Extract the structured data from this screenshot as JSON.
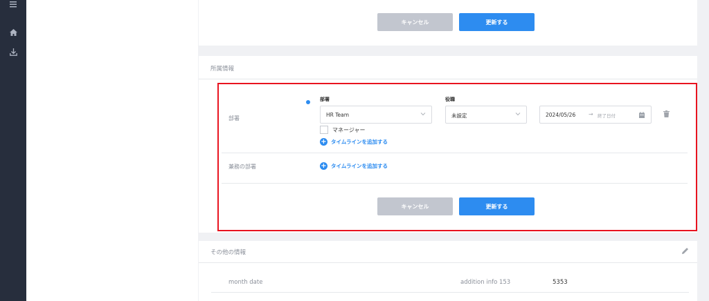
{
  "top_card": {
    "cancel_label": "キャンセル",
    "update_label": "更新する"
  },
  "affiliation": {
    "section_title": "所属情報",
    "department_row": {
      "label": "部署",
      "department_field_label": "部署",
      "department_value": "HR Team",
      "position_field_label": "役職",
      "position_value": "未設定",
      "start_date": "2024/05/26",
      "end_date_placeholder": "終了日付",
      "manager_checkbox_label": "マネージャー",
      "add_timeline_label": "タイムラインを追加する"
    },
    "concurrent_row": {
      "label": "兼務の部署",
      "add_timeline_label": "タイムラインを追加する"
    },
    "cancel_label": "キャンセル",
    "update_label": "更新する"
  },
  "other_info": {
    "section_title": "その他の情報",
    "row1_label": "month date",
    "row1_field_label": "addition info 153",
    "row1_field_value": "5353"
  },
  "icons": [
    "menu-icon",
    "home-icon",
    "download-icon",
    "chevron-down-icon",
    "calendar-icon",
    "trash-icon",
    "plus-circle-icon",
    "pencil-icon"
  ],
  "colors": {
    "primary": "#2d8cf0",
    "sidebar": "#272e3d",
    "highlight_border": "#e8131f",
    "cancel_button": "#c2c6cf"
  }
}
